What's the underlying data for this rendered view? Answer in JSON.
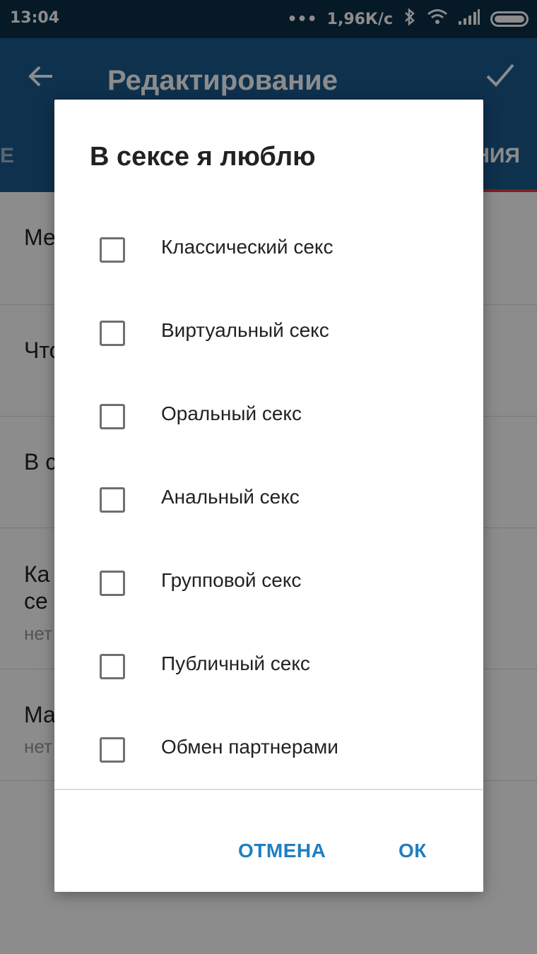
{
  "status": {
    "time": "13:04",
    "net_speed": "1,96К/с",
    "icons": [
      "more-icon",
      "bluetooth-icon",
      "wifi-icon",
      "signal-icon",
      "battery-icon"
    ]
  },
  "appbar": {
    "title": "Редактирование",
    "tab_left_fragment": "Е",
    "tab_right_fragment": "НИЯ",
    "color": "#1a5a8e",
    "indicator_color": "#e53935"
  },
  "background_rows": [
    {
      "label": "Ме",
      "sub": ""
    },
    {
      "label": "Что",
      "sub": ""
    },
    {
      "label": "В с",
      "sub": ""
    },
    {
      "label": "Ка\nсе",
      "sub": "нет"
    },
    {
      "label": "Ма",
      "sub": "нет"
    }
  ],
  "dialog": {
    "title": "В сексе я люблю",
    "options": [
      {
        "label": "Классический секс",
        "checked": false
      },
      {
        "label": "Виртуальный секс",
        "checked": false
      },
      {
        "label": "Оральный секс",
        "checked": false
      },
      {
        "label": "Анальный секс",
        "checked": false
      },
      {
        "label": "Групповой секс",
        "checked": false
      },
      {
        "label": "Публичный секс",
        "checked": false
      },
      {
        "label": "Обмен партнерами",
        "checked": false
      }
    ],
    "cancel_label": "ОТМЕНА",
    "ok_label": "ОК",
    "accent": "#1f7fc1"
  }
}
